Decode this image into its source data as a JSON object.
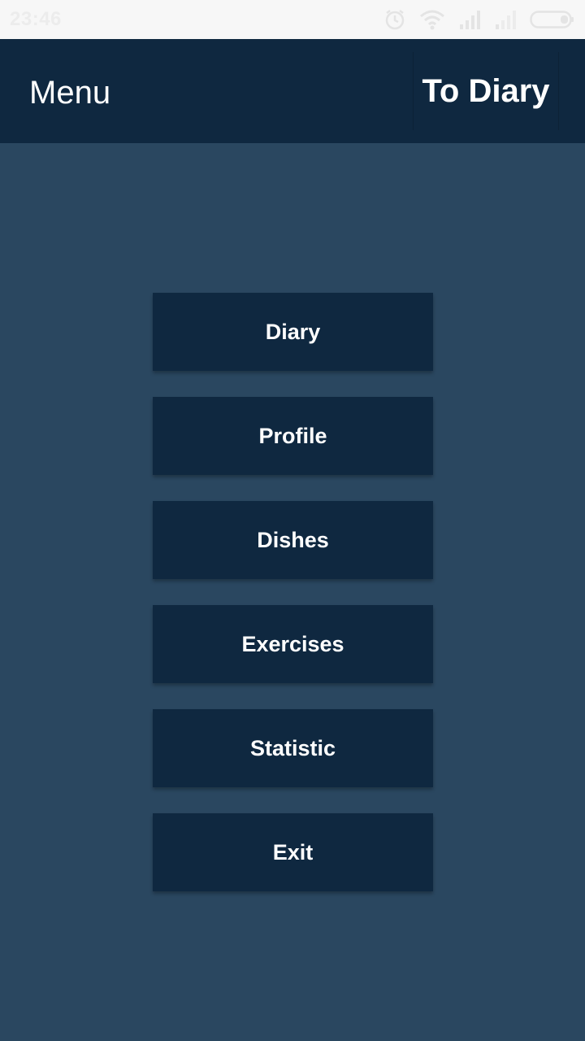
{
  "status_bar": {
    "time": "23:46",
    "icons": [
      "alarm-icon",
      "wifi-icon",
      "signal-icon",
      "signal-weak-icon",
      "battery-icon"
    ]
  },
  "app_bar": {
    "title": "Menu",
    "action_label": "To Diary"
  },
  "menu": {
    "items": [
      {
        "label": "Diary"
      },
      {
        "label": "Profile"
      },
      {
        "label": "Dishes"
      },
      {
        "label": "Exercises"
      },
      {
        "label": "Statistic"
      },
      {
        "label": "Exit"
      }
    ]
  },
  "colors": {
    "background": "#2a4760",
    "bar": "#0f2840",
    "button": "#0f2840",
    "text": "#ffffff"
  }
}
